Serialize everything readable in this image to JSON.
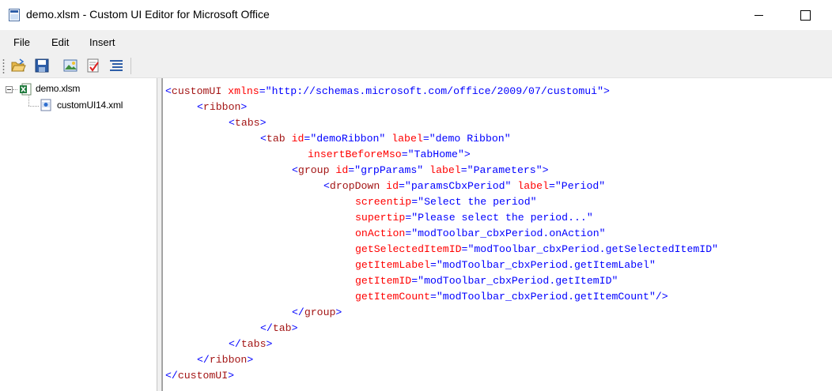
{
  "window": {
    "title": "demo.xlsm - Custom UI Editor for Microsoft Office"
  },
  "menu": {
    "items": [
      "File",
      "Edit",
      "Insert"
    ]
  },
  "toolbar": {
    "buttons": [
      "open-icon",
      "save-icon",
      "insert-icons-icon",
      "validate-icon",
      "generate-callbacks-icon"
    ]
  },
  "tree": {
    "root": {
      "label": "demo.xlsm",
      "icon": "excel-file-icon",
      "expanded": true
    },
    "children": [
      {
        "label": "customUI14.xml",
        "icon": "xml-file-icon"
      }
    ]
  },
  "colors": {
    "bracket": "#0000ff",
    "tag": "#a31515",
    "attribute": "#ff0000",
    "value": "#0000ff"
  },
  "editor": {
    "lines": [
      {
        "open": "<",
        "tag": "customUI",
        "attrs": [
          {
            "name": "xmlns",
            "value": "\"http://schemas.microsoft.com/office/2009/07/customui\""
          }
        ],
        "close": ">"
      },
      {
        "open": "<",
        "tag": "ribbon",
        "close": ">"
      },
      {
        "open": "<",
        "tag": "tabs",
        "close": ">"
      },
      {
        "open": "<",
        "tag": "tab",
        "attrs": [
          {
            "name": "id",
            "value": "\"demoRibbon\""
          },
          {
            "name": "label",
            "value": "\"demo Ribbon\""
          }
        ]
      },
      {
        "attrs": [
          {
            "name": "insertBeforeMso",
            "value": "\"TabHome\""
          }
        ],
        "close": ">"
      },
      {
        "open": "<",
        "tag": "group",
        "attrs": [
          {
            "name": "id",
            "value": "\"grpParams\""
          },
          {
            "name": "label",
            "value": "\"Parameters\""
          }
        ],
        "close": ">"
      },
      {
        "open": "<",
        "tag": "dropDown",
        "attrs": [
          {
            "name": "id",
            "value": "\"paramsCbxPeriod\""
          },
          {
            "name": "label",
            "value": "\"Period\""
          }
        ]
      },
      {
        "attrs": [
          {
            "name": "screentip",
            "value": "\"Select the period\""
          }
        ]
      },
      {
        "attrs": [
          {
            "name": "supertip",
            "value": "\"Please select the period...\""
          }
        ]
      },
      {
        "attrs": [
          {
            "name": "onAction",
            "value": "\"modToolbar_cbxPeriod.onAction\""
          }
        ]
      },
      {
        "attrs": [
          {
            "name": "getSelectedItemID",
            "value": "\"modToolbar_cbxPeriod.getSelectedItemID\""
          }
        ]
      },
      {
        "attrs": [
          {
            "name": "getItemLabel",
            "value": "\"modToolbar_cbxPeriod.getItemLabel\""
          }
        ]
      },
      {
        "attrs": [
          {
            "name": "getItemID",
            "value": "\"modToolbar_cbxPeriod.getItemID\""
          }
        ]
      },
      {
        "attrs": [
          {
            "name": "getItemCount",
            "value": "\"modToolbar_cbxPeriod.getItemCount\""
          }
        ],
        "close": "/>"
      },
      {
        "open": "</",
        "tag": "group",
        "close": ">"
      },
      {
        "open": "</",
        "tag": "tab",
        "close": ">"
      },
      {
        "open": "</",
        "tag": "tabs",
        "close": ">"
      },
      {
        "open": "</",
        "tag": "ribbon",
        "close": ">"
      },
      {
        "open": "</",
        "tag": "customUI",
        "close": ">"
      }
    ]
  }
}
